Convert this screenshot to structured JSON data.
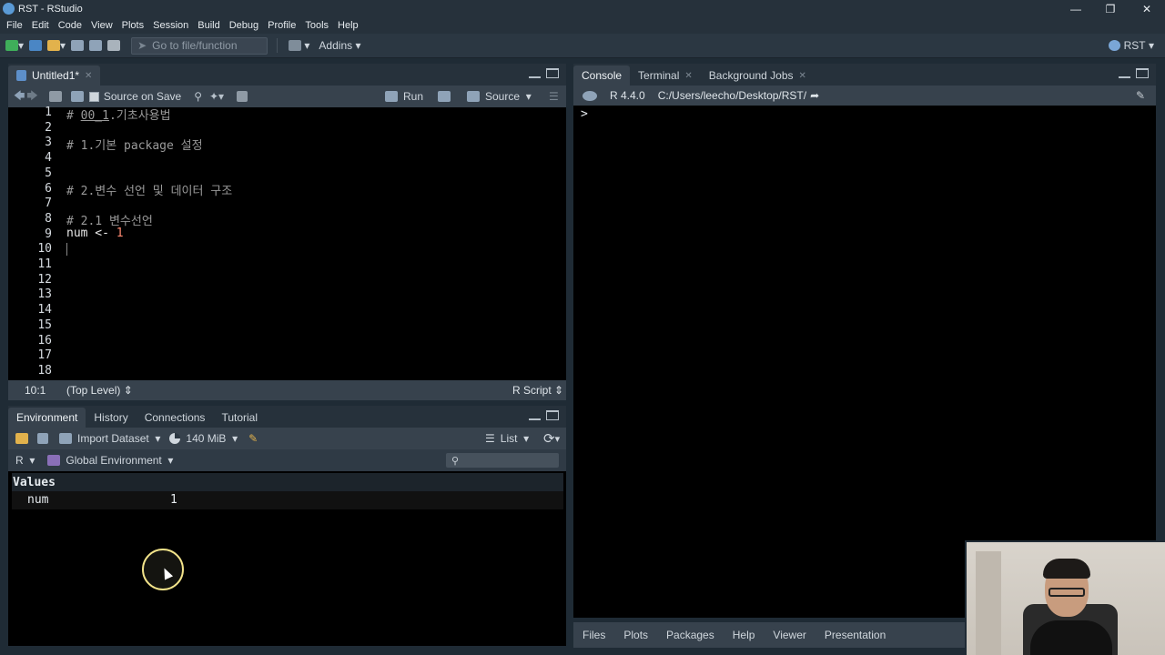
{
  "window": {
    "title": "RST - RStudio"
  },
  "menu": [
    "File",
    "Edit",
    "Code",
    "View",
    "Plots",
    "Session",
    "Build",
    "Debug",
    "Profile",
    "Tools",
    "Help"
  ],
  "toolbar": {
    "goto_placeholder": "Go to file/function",
    "addins": "Addins",
    "project": "RST"
  },
  "editor": {
    "tab": "Untitled1*",
    "source_on_save": "Source on Save",
    "run": "Run",
    "source": "Source",
    "line_numbers": [
      "1",
      "2",
      "3",
      "4",
      "5",
      "6",
      "7",
      "8",
      "9",
      "10",
      "11",
      "12",
      "13",
      "14",
      "15",
      "16",
      "17",
      "18"
    ],
    "lines": {
      "l1a": "# ",
      "l1b": "00_1",
      "l1c": ".기초사용법",
      "l3": "# 1.기본 package 설정",
      "l6": "# 2.변수 선언 및 데이터 구조",
      "l8": "# 2.1 변수선언",
      "l9a": "num <- ",
      "l9b": "1"
    },
    "status": {
      "position": "10:1",
      "scope": "(Top Level)",
      "filetype": "R Script"
    }
  },
  "environment": {
    "tabs": [
      "Environment",
      "History",
      "Connections",
      "Tutorial"
    ],
    "import_dataset": "Import Dataset",
    "memory": "140 MiB",
    "view_mode": "List",
    "language": "R",
    "scope": "Global Environment",
    "values_header": "Values",
    "rows": [
      {
        "name": "num",
        "value": "1"
      }
    ]
  },
  "console": {
    "tabs": [
      "Console",
      "Terminal",
      "Background Jobs"
    ],
    "r_version": "R 4.4.0",
    "path": "C:/Users/leecho/Desktop/RST/",
    "prompt": ">"
  },
  "files": {
    "tabs": [
      "Files",
      "Plots",
      "Packages",
      "Help",
      "Viewer",
      "Presentation"
    ]
  },
  "icons": [
    "r-logo-icon",
    "minimize-icon",
    "restore-icon",
    "close-icon",
    "new-file-icon",
    "open-icon",
    "save-icon",
    "print-icon",
    "grid-icon",
    "back-icon",
    "forward-icon",
    "search-icon",
    "wand-icon",
    "run-icon",
    "broom-icon",
    "refresh-icon",
    "pie-icon",
    "arrow-icon"
  ]
}
